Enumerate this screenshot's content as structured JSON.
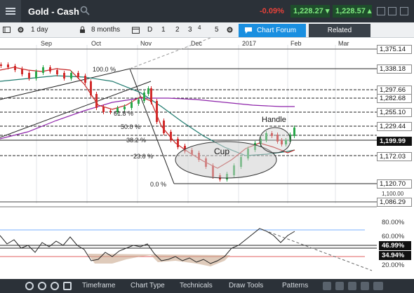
{
  "window": {
    "title": "Gold - Cash",
    "change": "-0.09%",
    "sell_price": "1,228.27",
    "buy_price": "1,228.57"
  },
  "toolbar": {
    "period": "1 day",
    "range": "8 months",
    "draw_d": "D",
    "draw_1": "1",
    "draw_2": "2",
    "draw_3": "3",
    "draw_4": "4",
    "draw_5": "5",
    "chart_forum": "Chart Forum",
    "related": "Related"
  },
  "months": [
    "Sep",
    "Oct",
    "Nov",
    "Dec",
    "2017",
    "Feb",
    "Mar"
  ],
  "price_levels": [
    {
      "value": "1,375.14",
      "dark": false
    },
    {
      "value": "1,338.18",
      "dark": false
    },
    {
      "value": "1,297.66",
      "dark": false
    },
    {
      "value": "1,282.68",
      "dark": false
    },
    {
      "value": "1,255.10",
      "dark": false
    },
    {
      "value": "1,229.44",
      "dark": false
    },
    {
      "value": "1,199.99",
      "dark": false
    },
    {
      "value": "1,172.03",
      "dark": false
    },
    {
      "value": "1,120.70",
      "dark": false
    },
    {
      "value": "1,100.00",
      "dark": false
    },
    {
      "value": "1,086.29",
      "dark": false
    }
  ],
  "fib_labels": [
    "100.0 %",
    "61.8 %",
    "50.0 %",
    "38.2 %",
    "23.6 %",
    "0.0 %"
  ],
  "annotations": {
    "cup": "Cup",
    "handle": "Handle"
  },
  "oscillator": {
    "levels": [
      "80.00%",
      "60.00%",
      "46.99%",
      "34.94%",
      "20.00%"
    ]
  },
  "bottom_tabs": [
    "Timeframe",
    "Chart Type",
    "Technicals",
    "Draw Tools",
    "Patterns"
  ],
  "colors": {
    "up_candle": "#2aa84a",
    "down_candle": "#d22b2b",
    "ma_fast": "#c62828",
    "ma_slow": "#8e24aa",
    "ma_mid": "#1e7a6e",
    "accent": "#1a8fe0"
  }
}
